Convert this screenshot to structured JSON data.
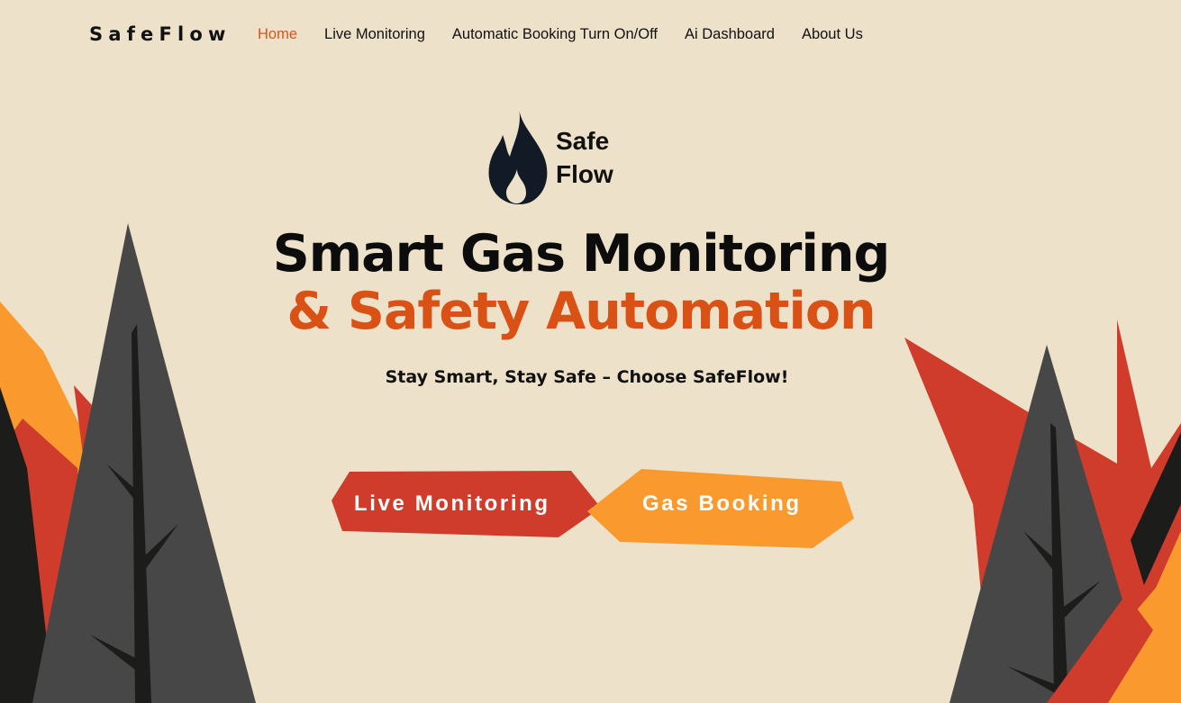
{
  "header": {
    "brand": "SafeFlow",
    "nav": [
      {
        "label": "Home",
        "active": true
      },
      {
        "label": "Live Monitoring",
        "active": false
      },
      {
        "label": "Automatic Booking Turn On/Off",
        "active": false
      },
      {
        "label": "Ai Dashboard",
        "active": false
      },
      {
        "label": "About Us",
        "active": false
      }
    ]
  },
  "logo": {
    "icon": "flame-icon",
    "line1": "Safe",
    "line2": "Flow"
  },
  "hero": {
    "title_line1": "Smart Gas Monitoring",
    "title_line2": "& Safety Automation",
    "tagline": "Stay Smart, Stay Safe – Choose SafeFlow!"
  },
  "buttons": {
    "live_monitoring": "Live Monitoring",
    "gas_booking": "Gas Booking"
  },
  "colors": {
    "background": "#ede2c9",
    "accent_orange": "#da5116",
    "button_red": "#d03c2c",
    "button_orange": "#fa9a2e",
    "tree_gray": "#474747",
    "dark": "#1c1d1b"
  }
}
